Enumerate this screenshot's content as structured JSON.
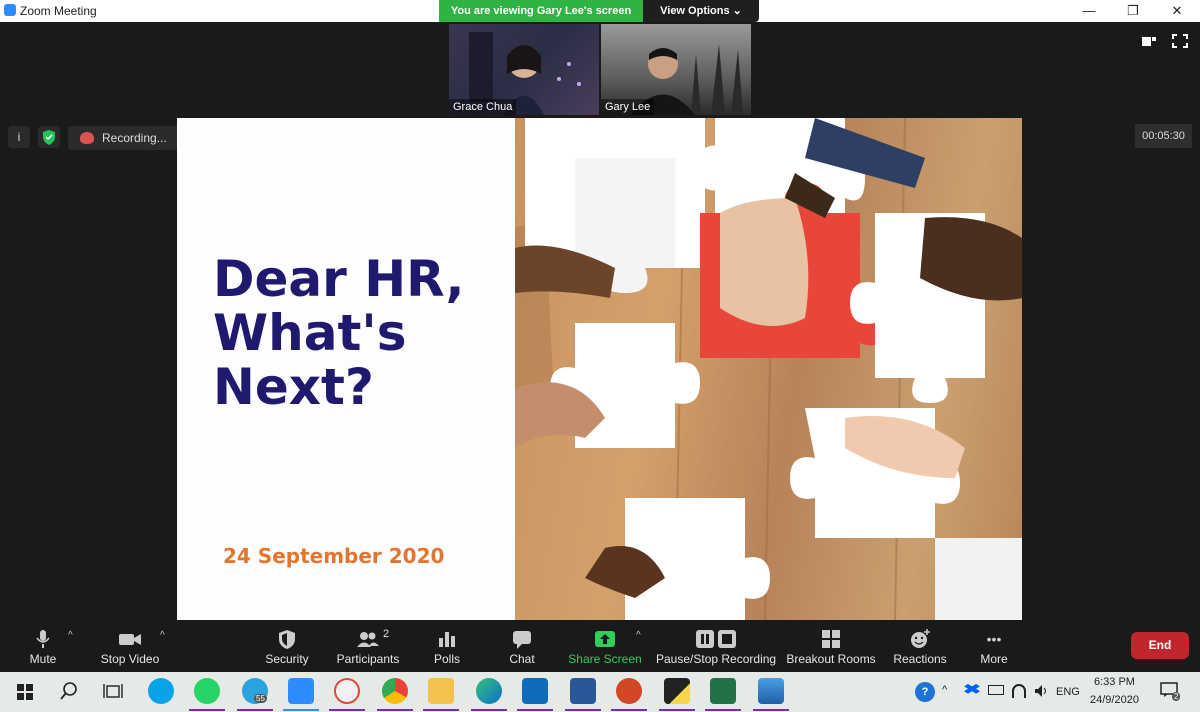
{
  "window": {
    "title": "Zoom Meeting",
    "minimize": "—",
    "restore": "❐",
    "close": "✕"
  },
  "banner": {
    "viewing": "You are viewing Gary Lee's screen",
    "view_options": "View Options ⌄"
  },
  "participants": [
    {
      "name": "Grace Chua"
    },
    {
      "name": "Gary Lee"
    }
  ],
  "status": {
    "recording": "Recording...",
    "timer": "00:05:30",
    "pause_glyph": "❚❚",
    "stop_glyph": "■",
    "info_glyph": "i"
  },
  "slide": {
    "title_line1": "Dear HR,",
    "title_line2": "What's",
    "title_line3": "Next?",
    "date": "24 September 2020",
    "title_color": "#1f1a6d",
    "date_color": "#e0762f"
  },
  "toolbar": {
    "mute": "Mute",
    "stop_video": "Stop Video",
    "security": "Security",
    "participants": "Participants",
    "participants_count": "2",
    "polls": "Polls",
    "chat": "Chat",
    "share_screen": "Share Screen",
    "pause_stop_recording": "Pause/Stop Recording",
    "breakout_rooms": "Breakout Rooms",
    "reactions": "Reactions",
    "more": "More",
    "more_glyph": "•••",
    "caret": "^",
    "end": "End"
  },
  "taskbar": {
    "apps": [
      "windows-start",
      "search",
      "task-view",
      "skype",
      "whatsapp",
      "telegram",
      "zoom",
      "snip",
      "chrome",
      "file-explorer",
      "edge",
      "outlook",
      "word",
      "powerpoint",
      "sticky-notes",
      "excel",
      "photos"
    ],
    "telegram_badge": "55",
    "help_glyph": "?",
    "up_glyph": "^",
    "language": "ENG",
    "time": "6:33 PM",
    "date": "24/9/2020",
    "notifications_badge": "2"
  },
  "colors": {
    "zoom_blue": "#2d8cff",
    "banner_green": "#2fb344",
    "end_red": "#c0262c",
    "share_green": "#2fcf5e"
  }
}
